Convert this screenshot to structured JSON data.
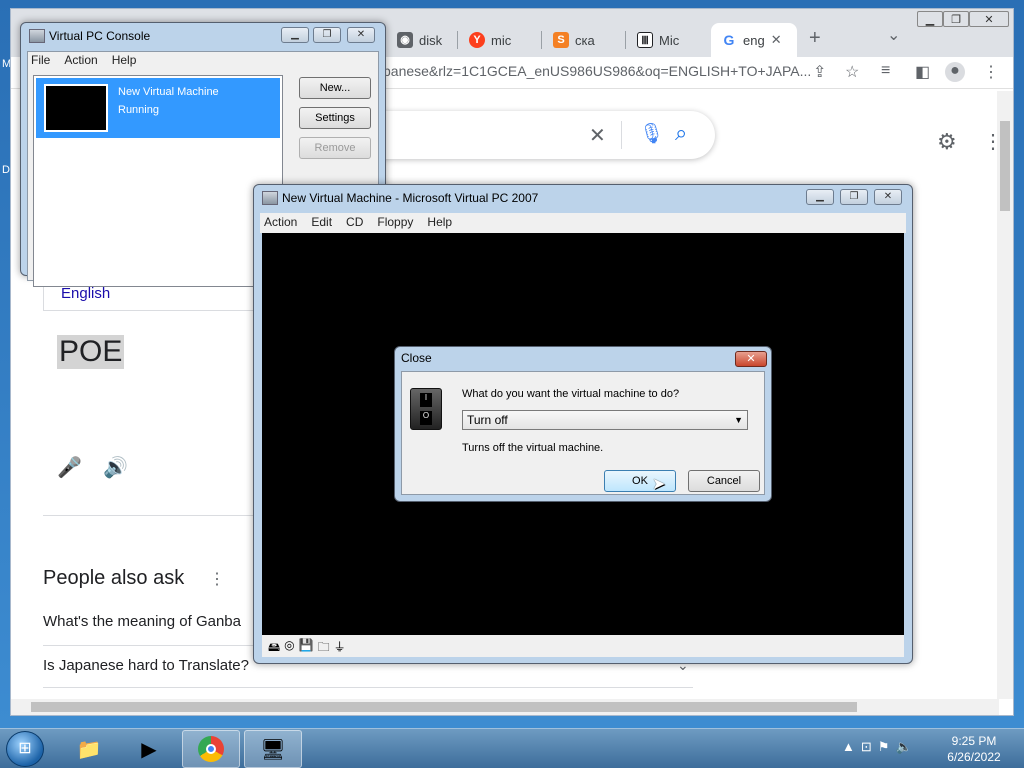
{
  "desktop": {
    "edge_labels": [
      "M",
      "D"
    ]
  },
  "browser": {
    "tabs": [
      {
        "label": "disk",
        "icon": "globe-icon",
        "color": "#5f6368"
      },
      {
        "label": "mic",
        "icon": "yandex-icon",
        "color": "#fc3f1d"
      },
      {
        "label": "ска",
        "icon": "stackexchange-icon",
        "color": "#f48024"
      },
      {
        "label": "Mic",
        "icon": "building-icon",
        "color": "#202124"
      },
      {
        "label": "eng",
        "icon": "google-icon",
        "color": "#4285f4",
        "active": true
      }
    ],
    "new_tab": "+",
    "tab_menu": "⌄",
    "url": "panese&rlz=1C1GCEA_enUS986US986&oq=ENGLISH+TO+JAPA...",
    "content": {
      "source_lang": "English",
      "translated": "POE",
      "people_also_ask": "People also ask",
      "questions": [
        "What's the meaning of Ganba",
        "Is Japanese hard to Translate?"
      ]
    }
  },
  "console": {
    "title": "Virtual PC Console",
    "menu": [
      "File",
      "Action",
      "Help"
    ],
    "vm": {
      "name": "New Virtual Machine",
      "status": "Running"
    },
    "buttons": {
      "new": "New...",
      "settings": "Settings",
      "remove": "Remove"
    }
  },
  "vmwin": {
    "title": "New Virtual Machine - Microsoft Virtual PC 2007",
    "menu": [
      "Action",
      "Edit",
      "CD",
      "Floppy",
      "Help"
    ]
  },
  "dialog": {
    "title": "Close",
    "question": "What do you want the virtual machine to do?",
    "selected": "Turn off",
    "description": "Turns off the virtual machine.",
    "ok": "OK",
    "cancel": "Cancel"
  },
  "taskbar": {
    "time": "9:25 PM",
    "date": "6/26/2022"
  }
}
